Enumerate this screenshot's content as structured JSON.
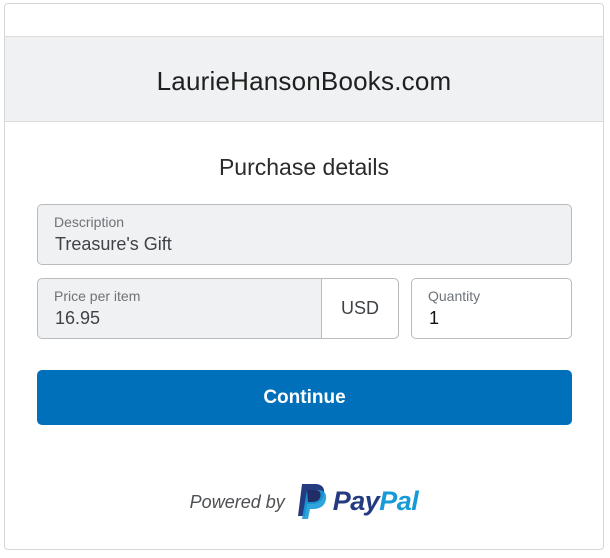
{
  "header": {
    "title": "LaurieHansonBooks.com"
  },
  "form": {
    "title": "Purchase details",
    "description": {
      "label": "Description",
      "value": "Treasure's Gift"
    },
    "price": {
      "label": "Price per item",
      "value": "16.95",
      "currency": "USD"
    },
    "quantity": {
      "label": "Quantity",
      "value": "1"
    },
    "continue_label": "Continue"
  },
  "footer": {
    "powered_by": "Powered by",
    "brand_pay": "Pay",
    "brand_pal": "Pal",
    "logo_icon": "paypal-logo-icon"
  },
  "colors": {
    "button": "#0070ba",
    "paypal_dark": "#253b80",
    "paypal_light": "#179bd7",
    "readonly_field": "#f0f1f2"
  }
}
